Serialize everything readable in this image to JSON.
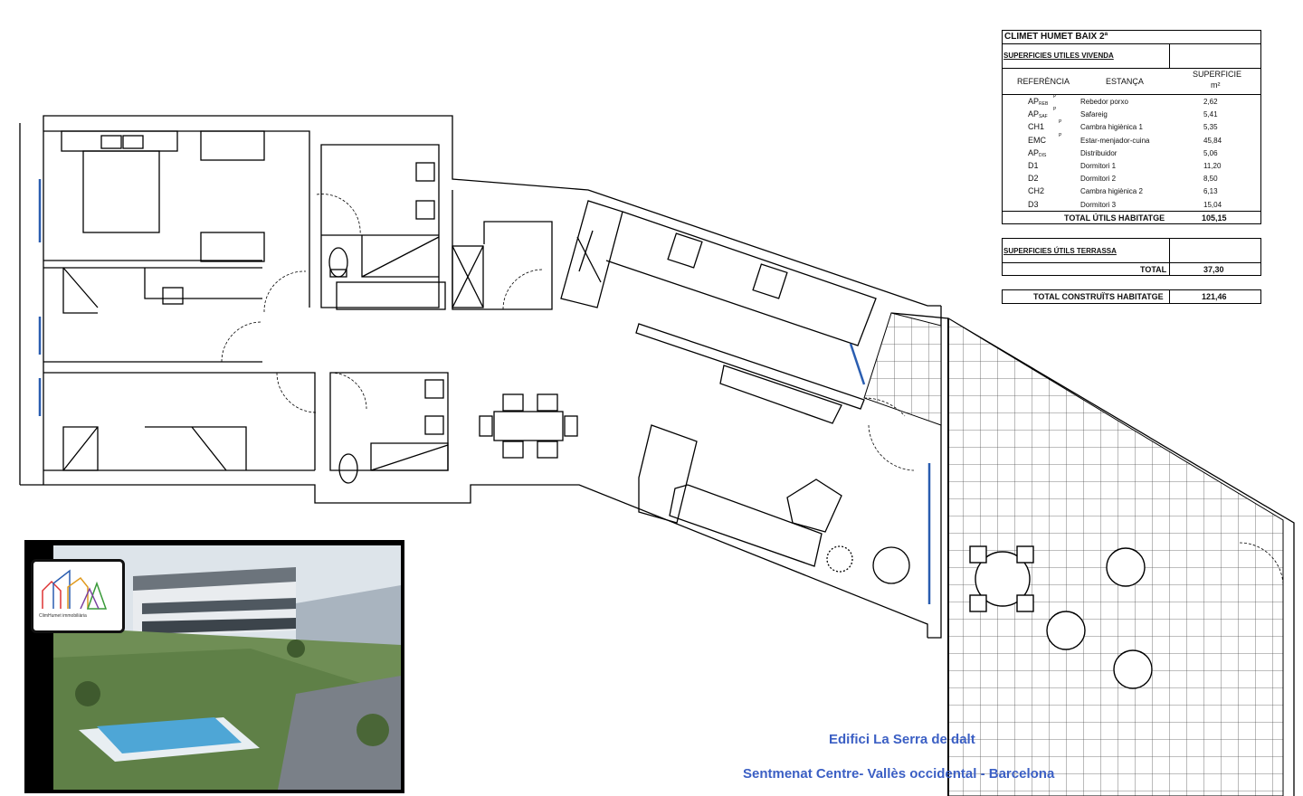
{
  "table": {
    "title": "CLIMET HUMET  BAIX 2ª",
    "section_vivenda": "SUPERFICIES UTILES VIVENDA",
    "headers": {
      "ref": "REFERÈNCIA",
      "estanca": "ESTANÇA",
      "sup": "SUPERFICIE",
      "unit": "m²"
    },
    "rows": [
      {
        "ref": "AP",
        "sub": "REB",
        "sup_mark": "P",
        "name": "Rebedor porxo",
        "value": "2,62"
      },
      {
        "ref": "AP",
        "sub": "SAF",
        "sup_mark": "P",
        "name": "Safareig",
        "value": "5,41"
      },
      {
        "ref": "CH1",
        "sub": "",
        "sup_mark": "P",
        "name": "Cambra higiènica 1",
        "value": "5,35"
      },
      {
        "ref": "EMC",
        "sub": "",
        "sup_mark": "P",
        "name": "Estar-menjador-cuina",
        "value": "45,84"
      },
      {
        "ref": "AP",
        "sub": "DIS",
        "sup_mark": "",
        "name": "Distribuidor",
        "value": "5,06"
      },
      {
        "ref": "D1",
        "sub": "",
        "sup_mark": "",
        "name": "Dormitori 1",
        "value": "11,20"
      },
      {
        "ref": "D2",
        "sub": "",
        "sup_mark": "",
        "name": "Dormitori 2",
        "value": "8,50"
      },
      {
        "ref": "CH2",
        "sub": "",
        "sup_mark": "",
        "name": "Cambra higiènica 2",
        "value": "6,13"
      },
      {
        "ref": "D3",
        "sub": "",
        "sup_mark": "",
        "name": "Dormitori 3",
        "value": "15,04"
      }
    ],
    "total_util_label": "TOTAL ÚTILS HABITATGE",
    "total_util_value": "105,15",
    "section_terrassa": "SUPERFICIES ÚTILS TERRASSA",
    "total_label": "TOTAL",
    "total_terrassa_value": "37,30",
    "total_construits_label": "TOTAL CONSTRUÏTS HABITATGE",
    "total_construits_value": "121,46"
  },
  "captions": {
    "building": "Edifici La Serra de dalt",
    "location": "Sentmenat Centre- Vallès occidental - Barcelona"
  },
  "logo": {
    "text": "ClimHumet  immobiliària"
  },
  "colors": {
    "caption": "#3b5fc4",
    "window": "#2a5db0",
    "wall": "#000000"
  }
}
